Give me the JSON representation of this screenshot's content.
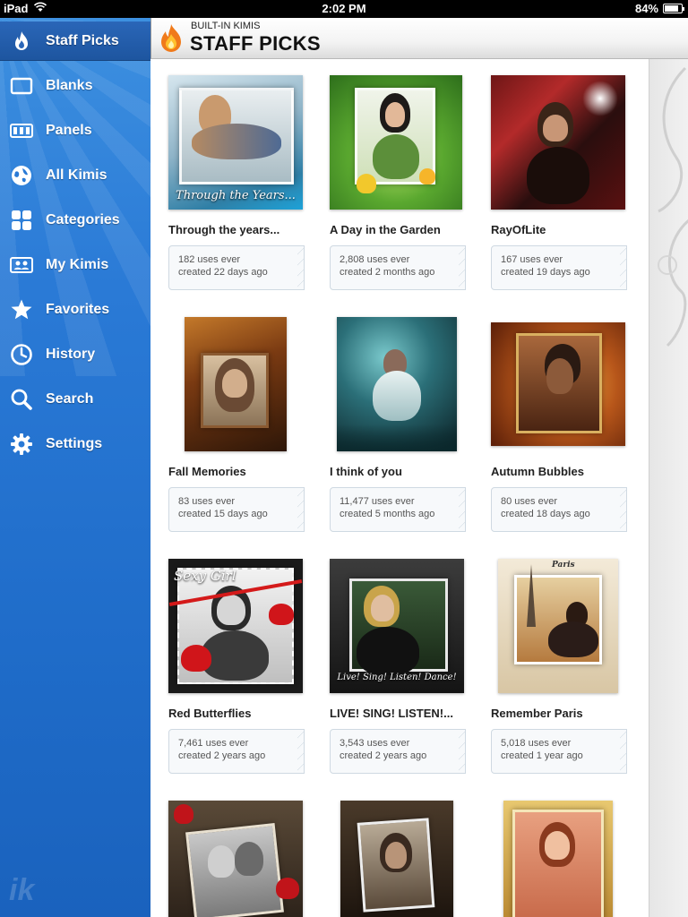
{
  "status_bar": {
    "device": "iPad",
    "time": "2:02 PM",
    "battery": "84%",
    "battery_level": 0.84
  },
  "sidebar": {
    "items": [
      {
        "label": "Staff Picks",
        "icon": "flame-icon",
        "active": true
      },
      {
        "label": "Blanks",
        "icon": "blank-frame-icon"
      },
      {
        "label": "Panels",
        "icon": "panels-icon"
      },
      {
        "label": "All Kimis",
        "icon": "globe-icon"
      },
      {
        "label": "Categories",
        "icon": "grid-icon"
      },
      {
        "label": "My Kimis",
        "icon": "photos-icon"
      },
      {
        "label": "Favorites",
        "icon": "star-icon"
      },
      {
        "label": "History",
        "icon": "clock-icon"
      },
      {
        "label": "Search",
        "icon": "search-icon"
      },
      {
        "label": "Settings",
        "icon": "gear-icon"
      }
    ],
    "logo": "ik"
  },
  "header": {
    "subtitle": "BUILT-IN KIMIS",
    "title": "STAFF PICKS"
  },
  "kimis": [
    {
      "title": "Through the years...",
      "uses": "182 uses ever",
      "created": "created 22 days ago",
      "caption": "Through the Years..."
    },
    {
      "title": "A Day in the Garden",
      "uses": "2,808 uses ever",
      "created": "created 2 months ago"
    },
    {
      "title": "RayOfLite",
      "uses": "167 uses ever",
      "created": "created 19 days ago"
    },
    {
      "title": "Fall Memories",
      "uses": "83 uses ever",
      "created": "created 15 days ago"
    },
    {
      "title": "I think of you",
      "uses": "11,477 uses ever",
      "created": "created 5 months ago"
    },
    {
      "title": "Autumn Bubbles",
      "uses": "80 uses ever",
      "created": "created 18 days ago"
    },
    {
      "title": "Red Butterflies",
      "uses": "7,461 uses ever",
      "created": "created 2 years ago",
      "caption": "Sexy Girl"
    },
    {
      "title": "LIVE! SING! LISTEN!...",
      "uses": "3,543 uses ever",
      "created": "created 2 years ago",
      "caption": "Live! Sing! Listen! Dance!"
    },
    {
      "title": "Remember Paris",
      "uses": "5,018 uses ever",
      "created": "created 1 year ago",
      "caption": "Paris"
    },
    {
      "title": "",
      "uses": "",
      "created": ""
    },
    {
      "title": "",
      "uses": "",
      "created": ""
    },
    {
      "title": "",
      "uses": "",
      "created": ""
    }
  ],
  "colors": {
    "sidebar_blue": "#2a7ad6",
    "active_blue": "#1d559f",
    "flame": "#f07a1a"
  }
}
